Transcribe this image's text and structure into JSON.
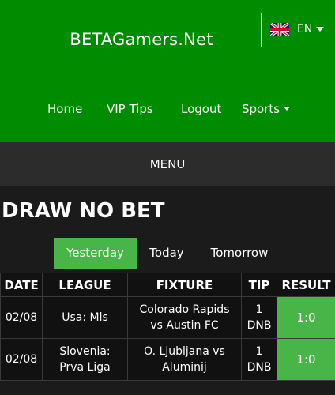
{
  "header": {
    "brand": "BETAGamers.Net",
    "language": "EN",
    "nav": [
      {
        "label": "Home"
      },
      {
        "label": "VIP Tips"
      },
      {
        "label": "Logout"
      },
      {
        "label": "Sports"
      }
    ]
  },
  "menu": {
    "label": "MENU"
  },
  "page": {
    "title": "DRAW NO BET"
  },
  "tabs": [
    {
      "label": "Yesterday",
      "active": true
    },
    {
      "label": "Today",
      "active": false
    },
    {
      "label": "Tomorrow",
      "active": false
    }
  ],
  "table": {
    "columns": [
      "DATE",
      "LEAGUE",
      "FIXTURE",
      "TIP",
      "RESULT"
    ],
    "rows": [
      {
        "date": "02/08",
        "league": "Usa: Mls",
        "fixture_home": "Colorado Rapids",
        "fixture_away": "vs Austin FC",
        "tip_line1": "1",
        "tip_line2": "DNB",
        "result": "1:0"
      },
      {
        "date": "02/08",
        "league_line1": "Slovenia:",
        "league_line2": "Prva Liga",
        "fixture_home": "O. Ljubljana vs",
        "fixture_away": "Aluminij",
        "tip_line1": "1",
        "tip_line2": "DNB",
        "result": "1:0"
      }
    ]
  },
  "colors": {
    "header_green": "#008c00",
    "accent_green": "#48b548",
    "menu_bar": "#2c2c2c",
    "background": "#1b1b1b"
  },
  "icons": {
    "flag": "uk-flag-icon",
    "dropdown": "caret-down-icon"
  }
}
